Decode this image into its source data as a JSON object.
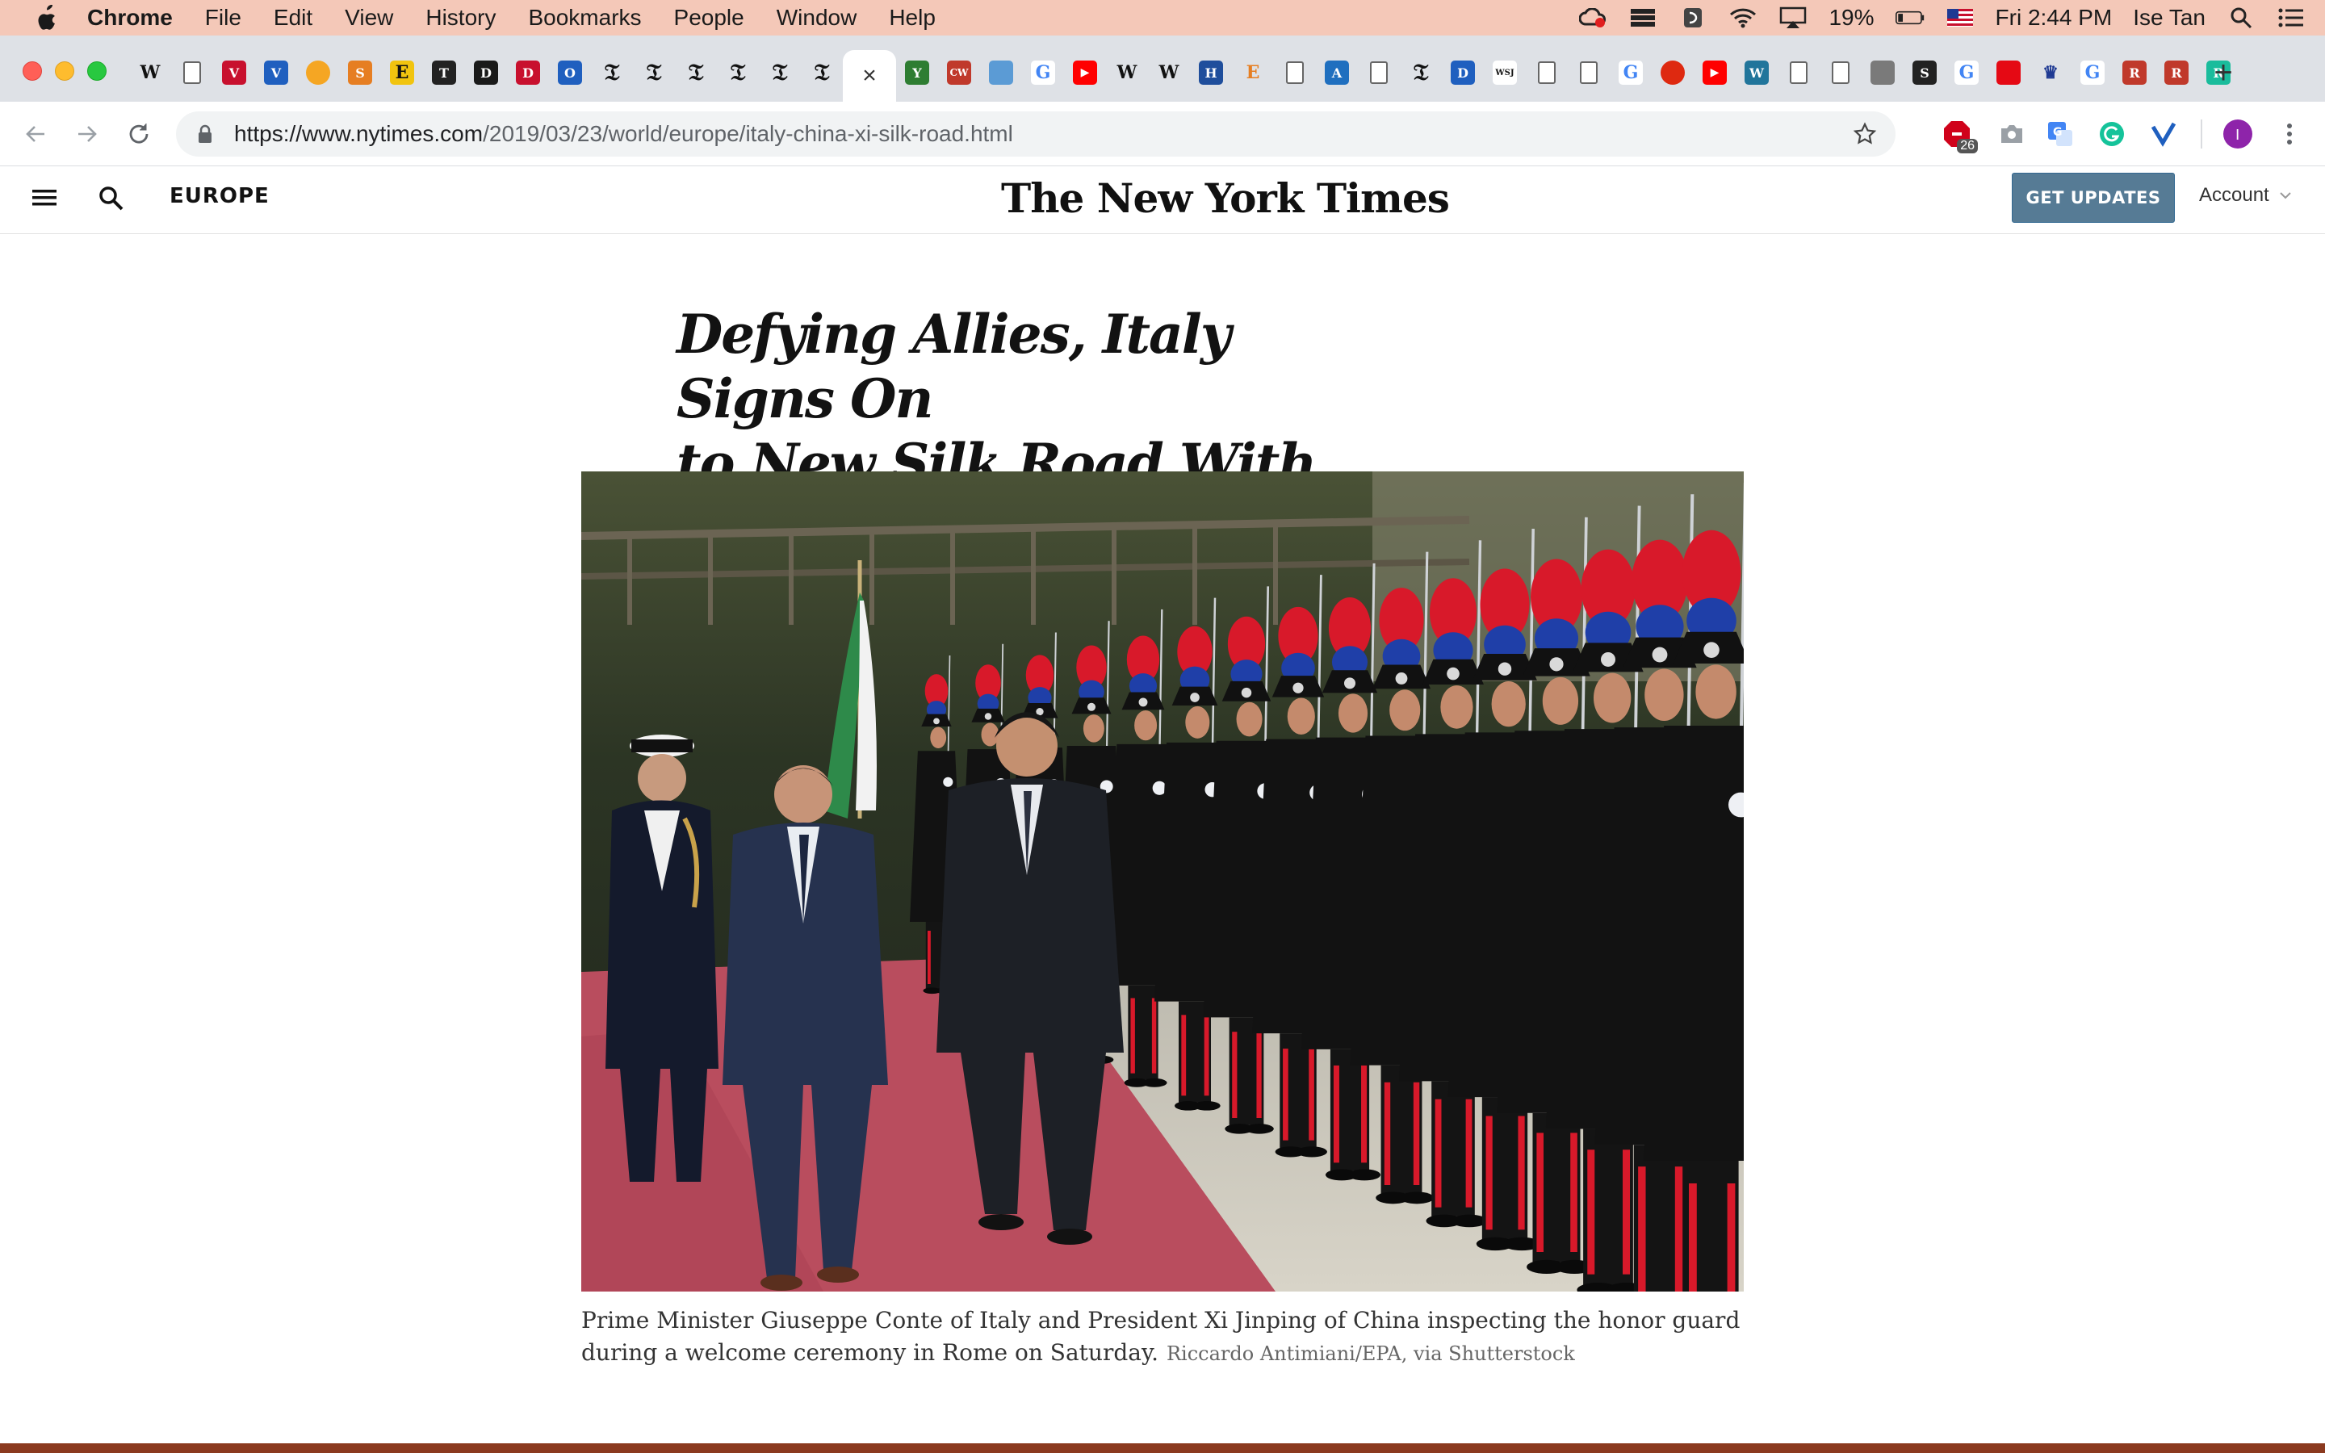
{
  "menubar": {
    "app_name": "Chrome",
    "items": [
      "File",
      "Edit",
      "View",
      "History",
      "Bookmarks",
      "People",
      "Window",
      "Help"
    ],
    "battery": "19%",
    "clock": "Fri 2:44 PM",
    "user": "Ise Tan"
  },
  "tabs": {
    "favicons": [
      "W",
      "doc",
      "V",
      "V",
      "speech",
      "S",
      "E",
      "T",
      "D",
      "D",
      "O",
      "nyt",
      "nyt",
      "nyt",
      "nyt",
      "nyt",
      "nyt",
      "active",
      "Y",
      "CW",
      "cloud",
      "G",
      "yt",
      "W",
      "W",
      "H",
      "E",
      "doc",
      "A",
      "doc",
      "nyt",
      "D",
      "WSJ",
      "doc",
      "doc",
      "G",
      "cn",
      "yt",
      "wp",
      "doc",
      "doc",
      "img",
      "S",
      "G",
      "red",
      "crown",
      "G",
      "R",
      "R",
      "R"
    ],
    "active_close": "×",
    "new_tab": "+"
  },
  "toolbar": {
    "url_host": "https://www.nytimes.com",
    "url_path": "/2019/03/23/world/europe/italy-china-xi-silk-road.html",
    "extension_badge": "26",
    "profile_initial": "I"
  },
  "nyt": {
    "section": "EUROPE",
    "masthead": "The New York Times",
    "get_updates": "GET UPDATES",
    "account": "Account"
  },
  "article": {
    "headline_line1": "Defying Allies, Italy Signs On",
    "headline_line2": "to New Silk Road With China",
    "caption": "Prime Minister Giuseppe Conte of Italy and President Xi Jinping of China inspecting the honor guard during a welcome ceremony in Rome on Saturday.",
    "credit": "Riccardo Antimiani/EPA, via Shutterstock"
  },
  "colors": {
    "menubar": "#f4c8b8",
    "tabstrip": "#dee1e6",
    "get_updates_bg": "#567b95",
    "carpet": "#b94d5e",
    "plume_red": "#d8192a",
    "plume_blue": "#1f3fa8"
  }
}
